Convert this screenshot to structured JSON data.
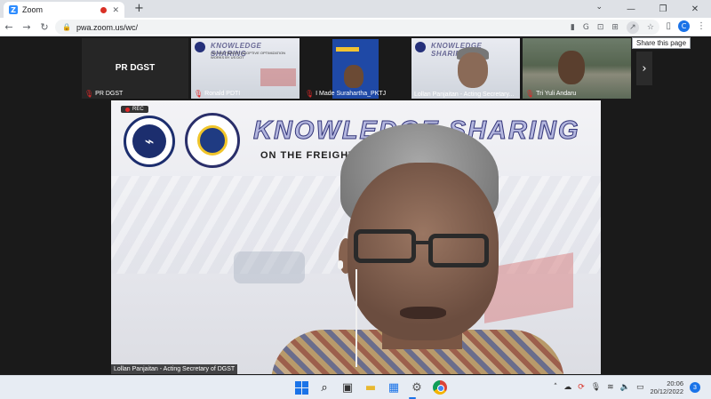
{
  "browser": {
    "tab_title": "Zoom",
    "tab_favicon_letter": "Z",
    "url": "pwa.zoom.us/wc/",
    "profile_initial": "C",
    "tooltip": "Share this page"
  },
  "gallery": {
    "tiles": [
      {
        "name": "PR DGST",
        "placeholder": "PR DGST"
      },
      {
        "name": "Ronald PDTI"
      },
      {
        "name": "I Made Surahartha_PKTJ"
      },
      {
        "name": "Lollan Panjaitan - Acting Secretary..."
      },
      {
        "name": "Tri Yuli Andaru"
      }
    ],
    "slide_title": "KNOWLEDGE SHARING",
    "slide_subtitle": "ON THE FREIGHT ADOPTIVE OPTIMIZATION WORKS BY US DOT"
  },
  "main": {
    "rec_label": "REC",
    "slide_title": "KNOWLEDGE SHARING",
    "slide_subtitle": "ON THE FREIGHT                ATION WORKS",
    "speaker_label": "Lollan Panjaitan - Acting Secretary of DGST"
  },
  "taskbar": {
    "time": "20:06",
    "date": "20/12/2022",
    "notification_count": "3"
  }
}
